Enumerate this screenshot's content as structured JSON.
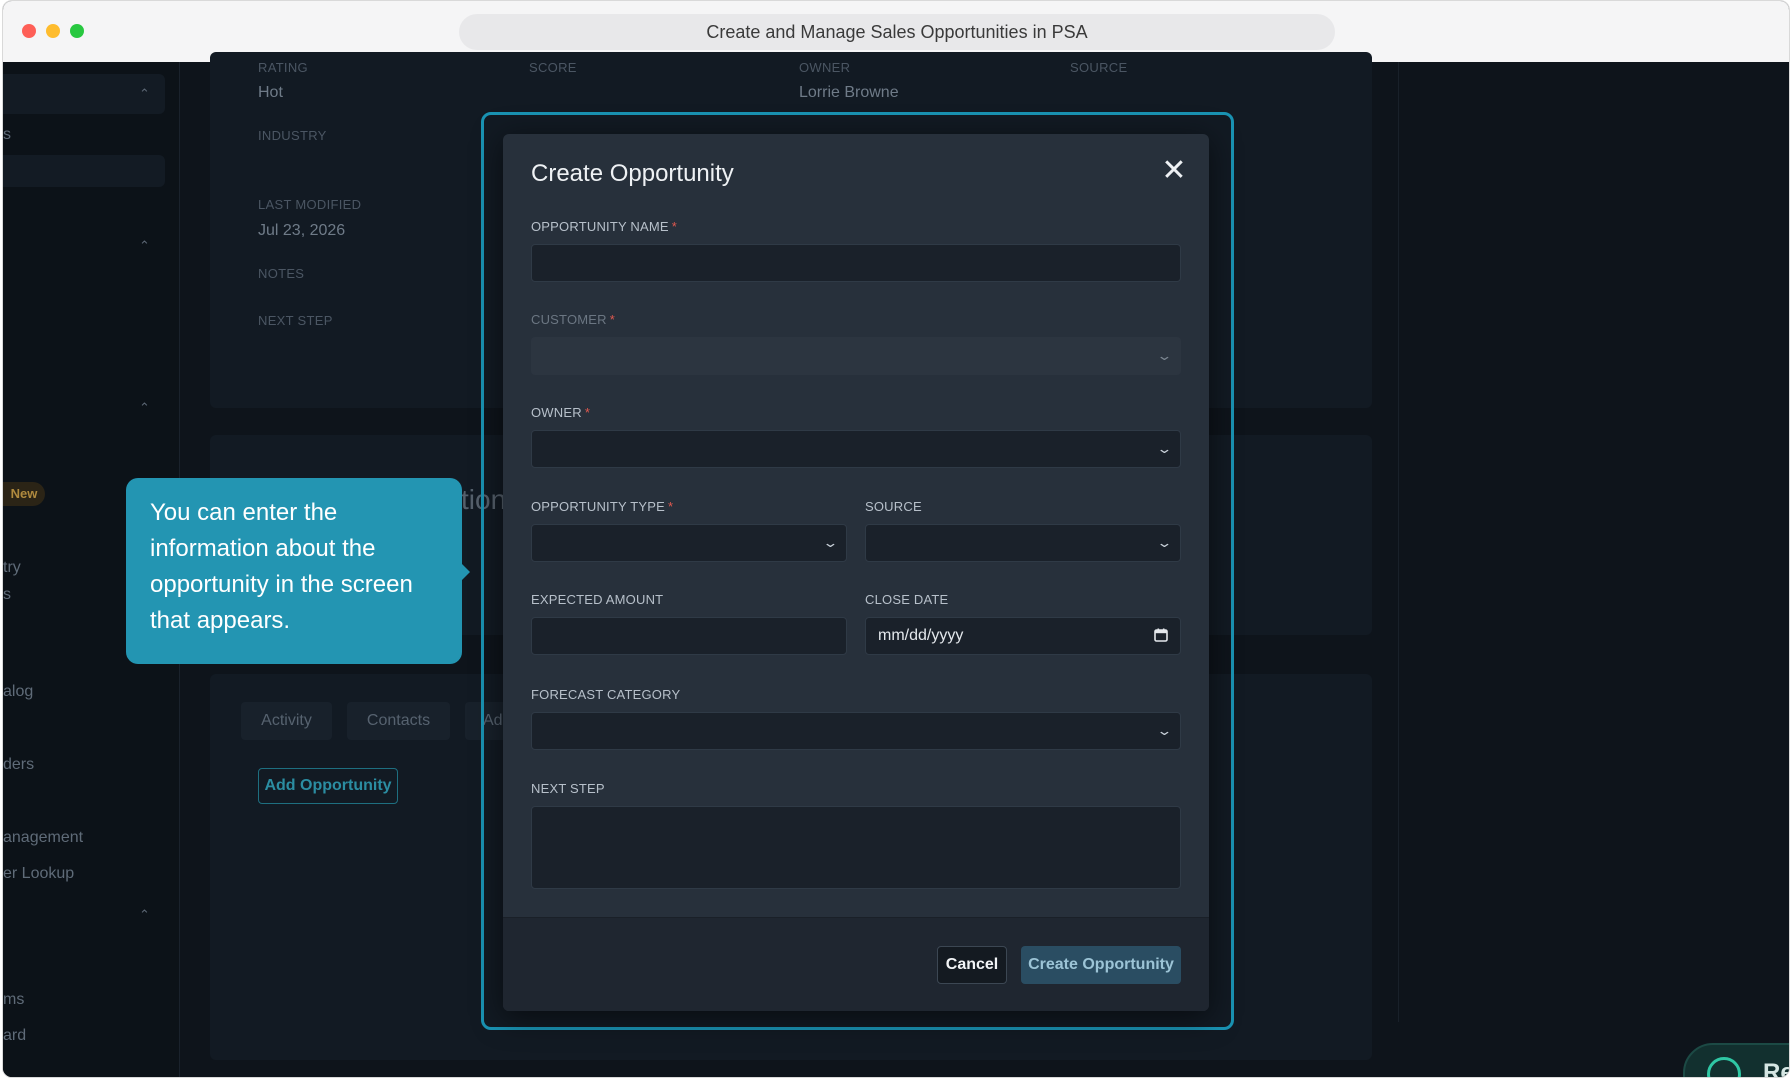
{
  "window": {
    "title": "Create and Manage Sales Opportunities in PSA"
  },
  "sidebar": {
    "items": [
      "s",
      "New",
      "try",
      "s",
      "alog",
      "ders",
      "anagement",
      "er Lookup",
      "ms",
      "ard"
    ]
  },
  "record": {
    "fields": {
      "rating_label": "RATING",
      "rating_value": "Hot",
      "score_label": "SCORE",
      "owner_label": "OWNER",
      "owner_value": "Lorrie Browne",
      "source_label": "SOURCE",
      "industry_label": "INDUSTRY",
      "last_modified_label": "LAST MODIFIED",
      "last_modified_value": "Jul 23, 2026",
      "notes_label": "NOTES",
      "next_step_label": "NEXT STEP"
    },
    "section_heading_fragment": "tion",
    "tabs": [
      "Activity",
      "Contacts",
      "Ad"
    ],
    "add_opportunity_label": "Add Opportunity"
  },
  "modal": {
    "title": "Create Opportunity",
    "fields": {
      "opportunity_name": {
        "label": "OPPORTUNITY NAME",
        "value": ""
      },
      "customer": {
        "label": "CUSTOMER",
        "value": ""
      },
      "owner": {
        "label": "OWNER",
        "value": ""
      },
      "opportunity_type": {
        "label": "OPPORTUNITY TYPE",
        "value": ""
      },
      "source": {
        "label": "SOURCE",
        "value": ""
      },
      "expected_amount": {
        "label": "EXPECTED AMOUNT",
        "value": ""
      },
      "close_date": {
        "label": "CLOSE DATE",
        "placeholder": "mm/dd/yyyy"
      },
      "forecast_category": {
        "label": "FORECAST CATEGORY",
        "value": ""
      },
      "next_step": {
        "label": "NEXT STEP",
        "value": ""
      }
    },
    "required_marker": "*",
    "cancel_label": "Cancel",
    "create_label": "Create Opportunity"
  },
  "tooltip": {
    "text": "You can enter the information about the opportunity in the screen that appears."
  },
  "resume_button": {
    "label": "Re"
  },
  "colors": {
    "accent": "#2395b2",
    "highlight": "#1a93b3",
    "required": "#e0594f"
  }
}
